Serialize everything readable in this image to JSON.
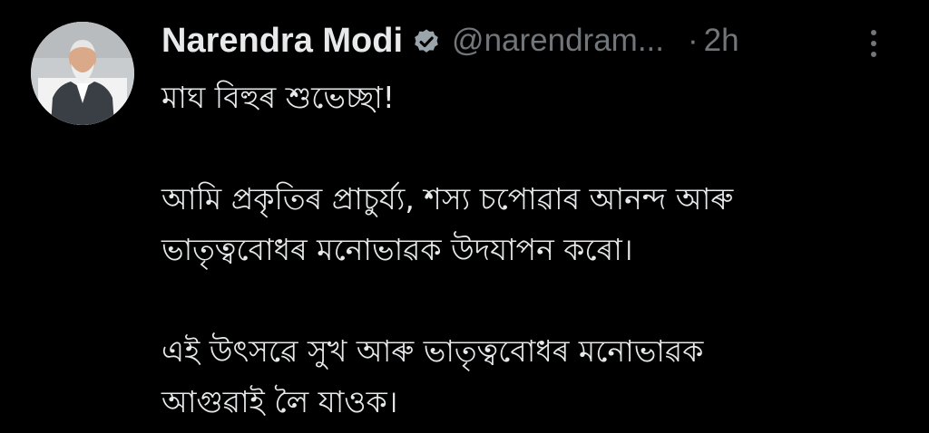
{
  "author": {
    "display_name": "Narendra Modi",
    "handle": "@narendram...",
    "verified": true,
    "avatar_icon": "profile-photo"
  },
  "meta": {
    "separator": "·",
    "time": "2h"
  },
  "icons": {
    "verified": "verified-badge-icon",
    "more": "more-vertical-icon"
  },
  "colors": {
    "background": "#000000",
    "text": "#e7e9ea",
    "muted": "#71767b"
  },
  "post": {
    "lines": [
      "মাঘ বিহুৰ শুভেচ্ছা!",
      "",
      "আমি প্ৰকৃতিৰ প্ৰাচুৰ্য্য, শস্য চপোৱাৰ আনন্দ আৰু",
      "ভাতৃত্ববোধৰ মনোভাৱক উদযাপন কৰো।",
      "",
      "এই উৎসৱে সুখ আৰু ভাতৃত্ববোধৰ মনোভাৱক",
      "আগুৱাই লৈ যাওক।"
    ]
  }
}
